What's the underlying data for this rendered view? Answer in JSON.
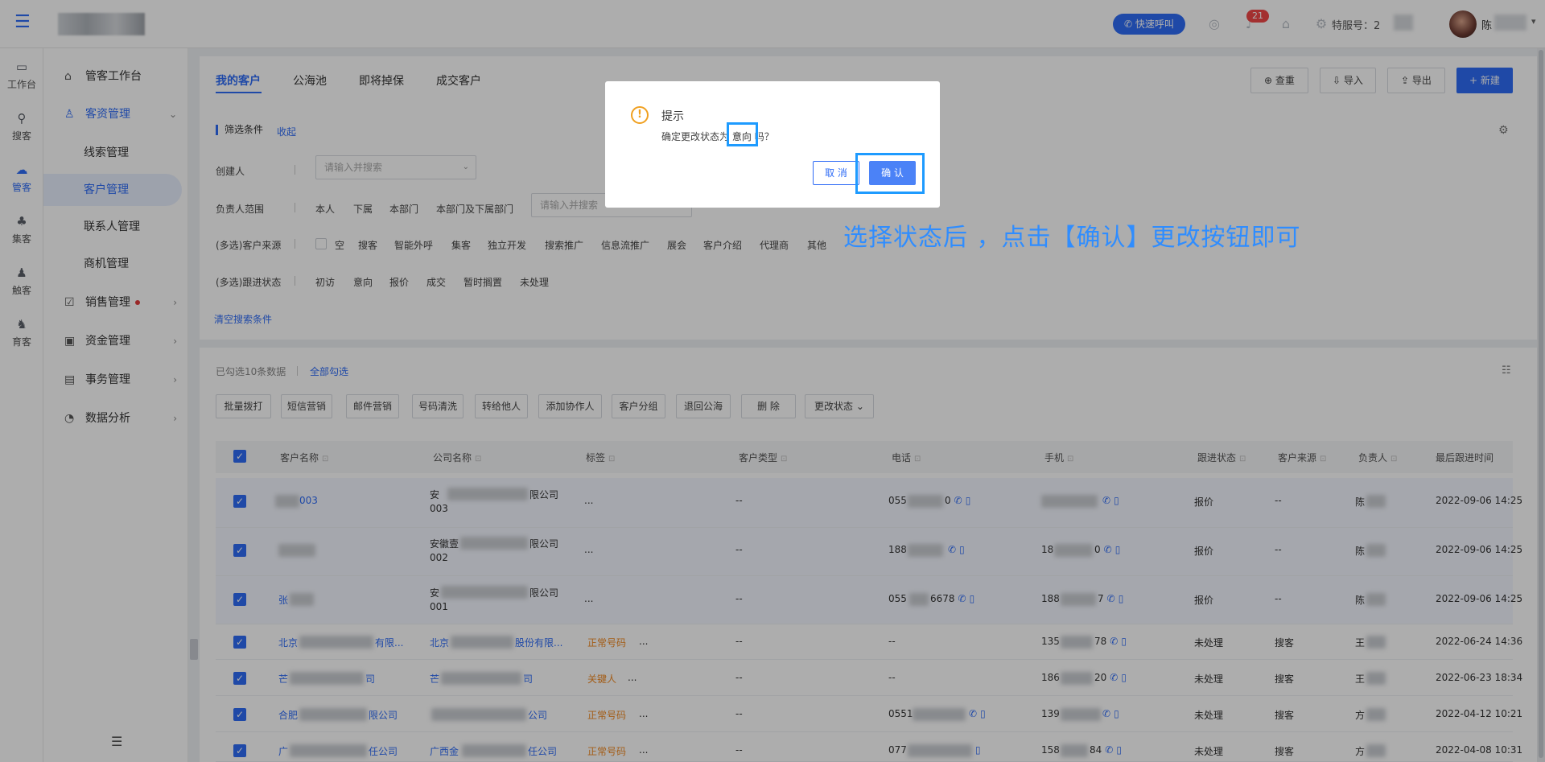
{
  "top": {
    "quick_call": "快速呼叫",
    "bell_badge": "21",
    "service_label": "特服号：",
    "service_value": "2",
    "user_name": "陈"
  },
  "rail": [
    "工作台",
    "搜客",
    "管客",
    "集客",
    "触客",
    "育客"
  ],
  "sidenav": {
    "workbench": "管客工作台",
    "customer_mgmt": "客资管理",
    "leads": "线索管理",
    "customers": "客户管理",
    "contacts": "联系人管理",
    "opportunities": "商机管理",
    "sales": "销售管理",
    "funds": "资金管理",
    "affairs": "事务管理",
    "analytics": "数据分析"
  },
  "tabs": [
    "我的客户",
    "公海池",
    "即将掉保",
    "成交客户"
  ],
  "toolbar": {
    "dedupe": "查重",
    "import": "导入",
    "export": "导出",
    "new": "新建"
  },
  "filter": {
    "title": "筛选条件",
    "collapse": "收起",
    "creator_label": "创建人",
    "creator_placeholder": "请输入并搜索",
    "owner_label": "负责人范围",
    "owner_options": [
      "本人",
      "下属",
      "本部门",
      "本部门及下属部门"
    ],
    "owner_placeholder": "请输入并搜索",
    "source_label": "(多选)客户来源",
    "source_options": [
      "空",
      "搜客",
      "智能外呼",
      "集客",
      "独立开发",
      "搜索推广",
      "信息流推广",
      "展会",
      "客户介绍",
      "代理商",
      "其他"
    ],
    "status_label": "(多选)跟进状态",
    "status_options": [
      "初访",
      "意向",
      "报价",
      "成交",
      "暂时搁置",
      "未处理"
    ],
    "clear": "清空搜索条件"
  },
  "list": {
    "selected_info": "已勾选10条数据",
    "select_all": "全部勾选",
    "actions": [
      "批量拨打",
      "短信营销",
      "邮件营销",
      "号码清洗",
      "转给他人",
      "添加协作人",
      "客户分组",
      "退回公海",
      "删 除",
      "更改状态"
    ],
    "columns": [
      "客户名称",
      "公司名称",
      "标签",
      "客户类型",
      "电话",
      "手机",
      "跟进状态",
      "客户来源",
      "负责人",
      "最后跟进时间"
    ]
  },
  "rows": [
    {
      "name": "003",
      "company": "安",
      "company_tail": "限公司",
      "company_l2": "003",
      "tag": "...",
      "type": "--",
      "phone": "055",
      "phone_tail": "0",
      "mobile": "",
      "mobile_tail": "",
      "status": "报价",
      "source": "--",
      "owner": "陈",
      "time": "2022-09-06 14:25"
    },
    {
      "name": "",
      "company": "安徽壹",
      "company_tail": "限公司",
      "company_l2": "002",
      "tag": "...",
      "type": "--",
      "phone": "188",
      "phone_tail": "",
      "mobile": "18",
      "mobile_tail": "0",
      "status": "报价",
      "source": "--",
      "owner": "陈",
      "time": "2022-09-06 14:25"
    },
    {
      "name": "张",
      "company": "安",
      "company_tail": "限公司",
      "company_l2": "001",
      "tag": "...",
      "type": "--",
      "phone": "055",
      "phone_tail": "6678",
      "mobile": "188",
      "mobile_tail": "7",
      "status": "报价",
      "source": "--",
      "owner": "陈",
      "time": "2022-09-06 14:25"
    },
    {
      "name": "北京",
      "name_tail": "有限...",
      "company": "北京",
      "company_tail": "股份有限...",
      "tag": "正常号码",
      "tag_more": "...",
      "type": "--",
      "phone": "--",
      "phone_tail": "",
      "mobile": "135",
      "mobile_tail": "78",
      "status": "未处理",
      "source": "搜客",
      "owner": "王",
      "time": "2022-06-24 14:36"
    },
    {
      "name": "芒",
      "name_tail": "司",
      "company": "芒",
      "company_tail": "司",
      "tag": "关键人",
      "tag_more": "...",
      "type": "--",
      "phone": "--",
      "phone_tail": "",
      "mobile": "186",
      "mobile_tail": "20",
      "status": "未处理",
      "source": "搜客",
      "owner": "王",
      "time": "2022-06-23 18:34"
    },
    {
      "name": "合肥",
      "name_tail": "限公司",
      "company": "",
      "company_tail": "公司",
      "tag": "正常号码",
      "tag_more": "...",
      "type": "--",
      "phone": "0551",
      "phone_tail": "",
      "mobile": "139",
      "mobile_tail": "",
      "status": "未处理",
      "source": "搜客",
      "owner": "方",
      "time": "2022-04-12 10:21"
    },
    {
      "name": "广",
      "name_tail": "任公司",
      "company": "广西金",
      "company_tail": "任公司",
      "tag": "正常号码",
      "tag_more": "...",
      "type": "--",
      "phone": "077",
      "phone_tail": "",
      "mobile": "158",
      "mobile_tail": "84",
      "status": "未处理",
      "source": "搜客",
      "owner": "方",
      "time": "2022-04-08 10:31"
    }
  ],
  "dialog": {
    "title": "提示",
    "message_prefix": "确定更改状态为",
    "message_value": "意向",
    "message_suffix": "吗？",
    "cancel": "取 消",
    "confirm": "确 认"
  },
  "annotation": "选择状态后 ，点击【确认】更改按钮即可",
  "colors": {
    "primary": "#2f6cf6",
    "warning": "#f0a020",
    "highlight": "#1e9bff",
    "tag_orange": "#f08a24"
  }
}
